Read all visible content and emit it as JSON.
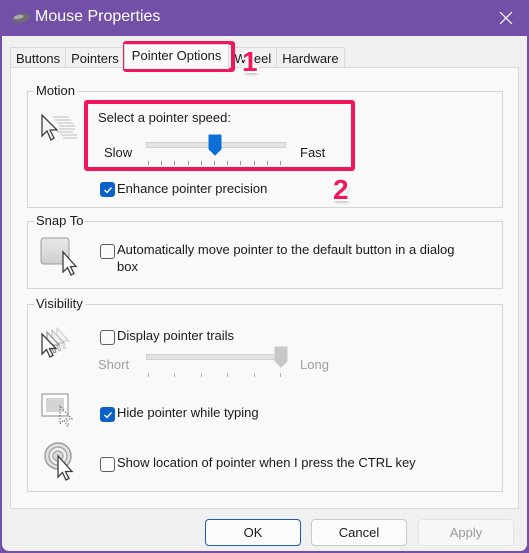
{
  "window": {
    "title": "Mouse Properties",
    "icon": "mouse-icon",
    "close_icon": "close-icon",
    "accent_color": "#7350a8"
  },
  "tabs": [
    {
      "label": "Buttons",
      "active": false
    },
    {
      "label": "Pointers",
      "active": false
    },
    {
      "label": "Pointer Options",
      "active": true
    },
    {
      "label": "Wheel",
      "active": false
    },
    {
      "label": "Hardware",
      "active": false
    }
  ],
  "motion": {
    "group_label": "Motion",
    "icon": "pointer-speed-icon",
    "speed_label": "Select a pointer speed:",
    "slow_label": "Slow",
    "fast_label": "Fast",
    "speed_value_fraction": 0.5,
    "speed_tick_count": 11,
    "enhance_precision_label": "Enhance pointer precision",
    "enhance_precision_checked": true
  },
  "snap_to": {
    "group_label": "Snap To",
    "icon": "snap-to-icon",
    "auto_move_label_line1": "Automatically move pointer to the default button in a dialog",
    "auto_move_label_line2": "box",
    "auto_move_checked": false
  },
  "visibility": {
    "group_label": "Visibility",
    "trails_icon": "pointer-trails-icon",
    "trails_label": "Display pointer trails",
    "trails_checked": false,
    "short_label": "Short",
    "long_label": "Long",
    "trails_value_fraction": 1.0,
    "trails_tick_count": 6,
    "trails_slider_enabled": false,
    "hide_icon": "hide-pointer-icon",
    "hide_while_typing_label": "Hide pointer while typing",
    "hide_while_typing_checked": true,
    "location_icon": "pointer-location-icon",
    "show_location_label": "Show location of pointer when I press the CTRL key",
    "show_location_checked": false
  },
  "buttons": {
    "ok": "OK",
    "cancel": "Cancel",
    "apply": "Apply",
    "apply_enabled": false
  },
  "annotations": [
    {
      "label": "1",
      "color": "#f2165a",
      "target": "tab-pointer-options"
    },
    {
      "label": "2",
      "color": "#f2165a",
      "target": "pointer-speed-slider"
    }
  ]
}
